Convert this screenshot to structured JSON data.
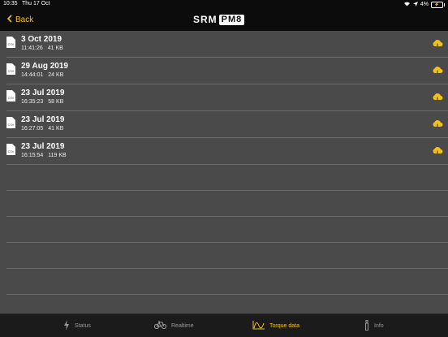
{
  "status_bar": {
    "time": "10:35",
    "date": "Thu 17 Oct",
    "battery": "4%"
  },
  "nav": {
    "back_label": "Back",
    "logo_srm": "SRM",
    "logo_pm": "PM8"
  },
  "files": [
    {
      "title": "3 Oct 2019",
      "time": "11:41:26",
      "size": "41 KB",
      "type": "CSV"
    },
    {
      "title": "29 Aug 2019",
      "time": "14:44:01",
      "size": "24 KB",
      "type": "CSV"
    },
    {
      "title": "23 Jul 2019",
      "time": "16:35:23",
      "size": "58 KB",
      "type": "CSV"
    },
    {
      "title": "23 Jul 2019",
      "time": "16:27:05",
      "size": "41 KB",
      "type": "CSV"
    },
    {
      "title": "23 Jul 2019",
      "time": "16:15:54",
      "size": "119 KB",
      "type": "CSV"
    }
  ],
  "tabs": [
    {
      "label": "Status",
      "icon": "lightning-icon"
    },
    {
      "label": "Realtime",
      "icon": "bicycle-icon"
    },
    {
      "label": "Torque data",
      "icon": "torque-curve-icon"
    },
    {
      "label": "Info",
      "icon": "info-icon"
    }
  ],
  "active_tab": "Torque data",
  "colors": {
    "accent": "#f2c21a",
    "background": "#4a4a4a",
    "bar": "#0c0c0c"
  }
}
